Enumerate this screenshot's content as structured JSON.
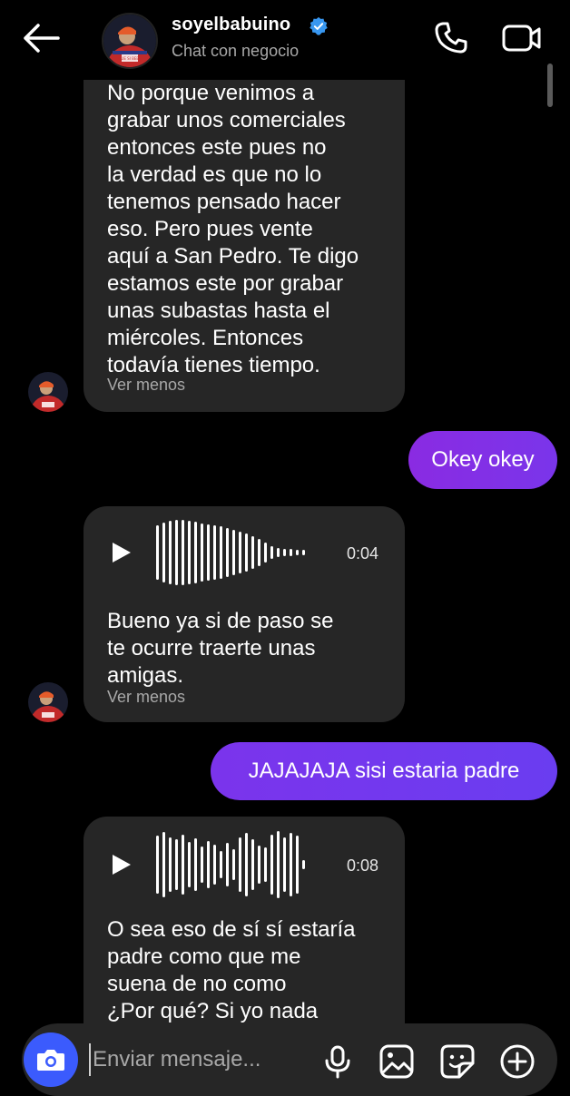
{
  "header": {
    "username": "soyelbabuino",
    "subtitle": "Chat con negocio",
    "avatar_text": "QUE SI BEBE"
  },
  "messages": [
    {
      "type": "incoming-text",
      "text": "No porque venimos a\ngrabar unos comerciales\nentonces este pues no\nla verdad es que no lo\ntenemos pensado hacer\neso. Pero pues vente\naquí a San Pedro. Te digo\nestamos este por grabar\nunas subastas hasta el\nmiércoles. Entonces\ntodavía tienes tiempo.",
      "toggle": "Ver menos"
    },
    {
      "type": "outgoing",
      "text": "Okey okey"
    },
    {
      "type": "incoming-voice",
      "duration": "0:04",
      "transcript": "Bueno ya si de paso se\nte ocurre traerte unas\namigas.",
      "toggle": "Ver menos"
    },
    {
      "type": "outgoing",
      "text": "JAJAJAJA sisi estaria padre"
    },
    {
      "type": "incoming-voice",
      "duration": "0:08",
      "transcript": "O sea eso de sí sí estaría\npadre como que me\nsuena de no como\n¿Por qué? Si yo nada"
    }
  ],
  "composer": {
    "placeholder": "Enviar mensaje..."
  },
  "icons": {
    "back": "arrow-left-icon",
    "verified": "verified-badge-icon",
    "call": "phone-icon",
    "video": "video-camera-icon",
    "play": "play-icon",
    "camera": "camera-icon",
    "mic": "microphone-icon",
    "gallery": "image-icon",
    "sticker": "sticker-icon",
    "add": "plus-circle-icon"
  },
  "colors": {
    "background": "#000000",
    "incoming_bubble": "#262626",
    "outgoing_bubble_start": "#8a2be2",
    "outgoing_bubble_end": "#6a3df0",
    "camera_button": "#3b5bfd",
    "verified": "#3897f0",
    "secondary_text": "#a8a8a8"
  }
}
